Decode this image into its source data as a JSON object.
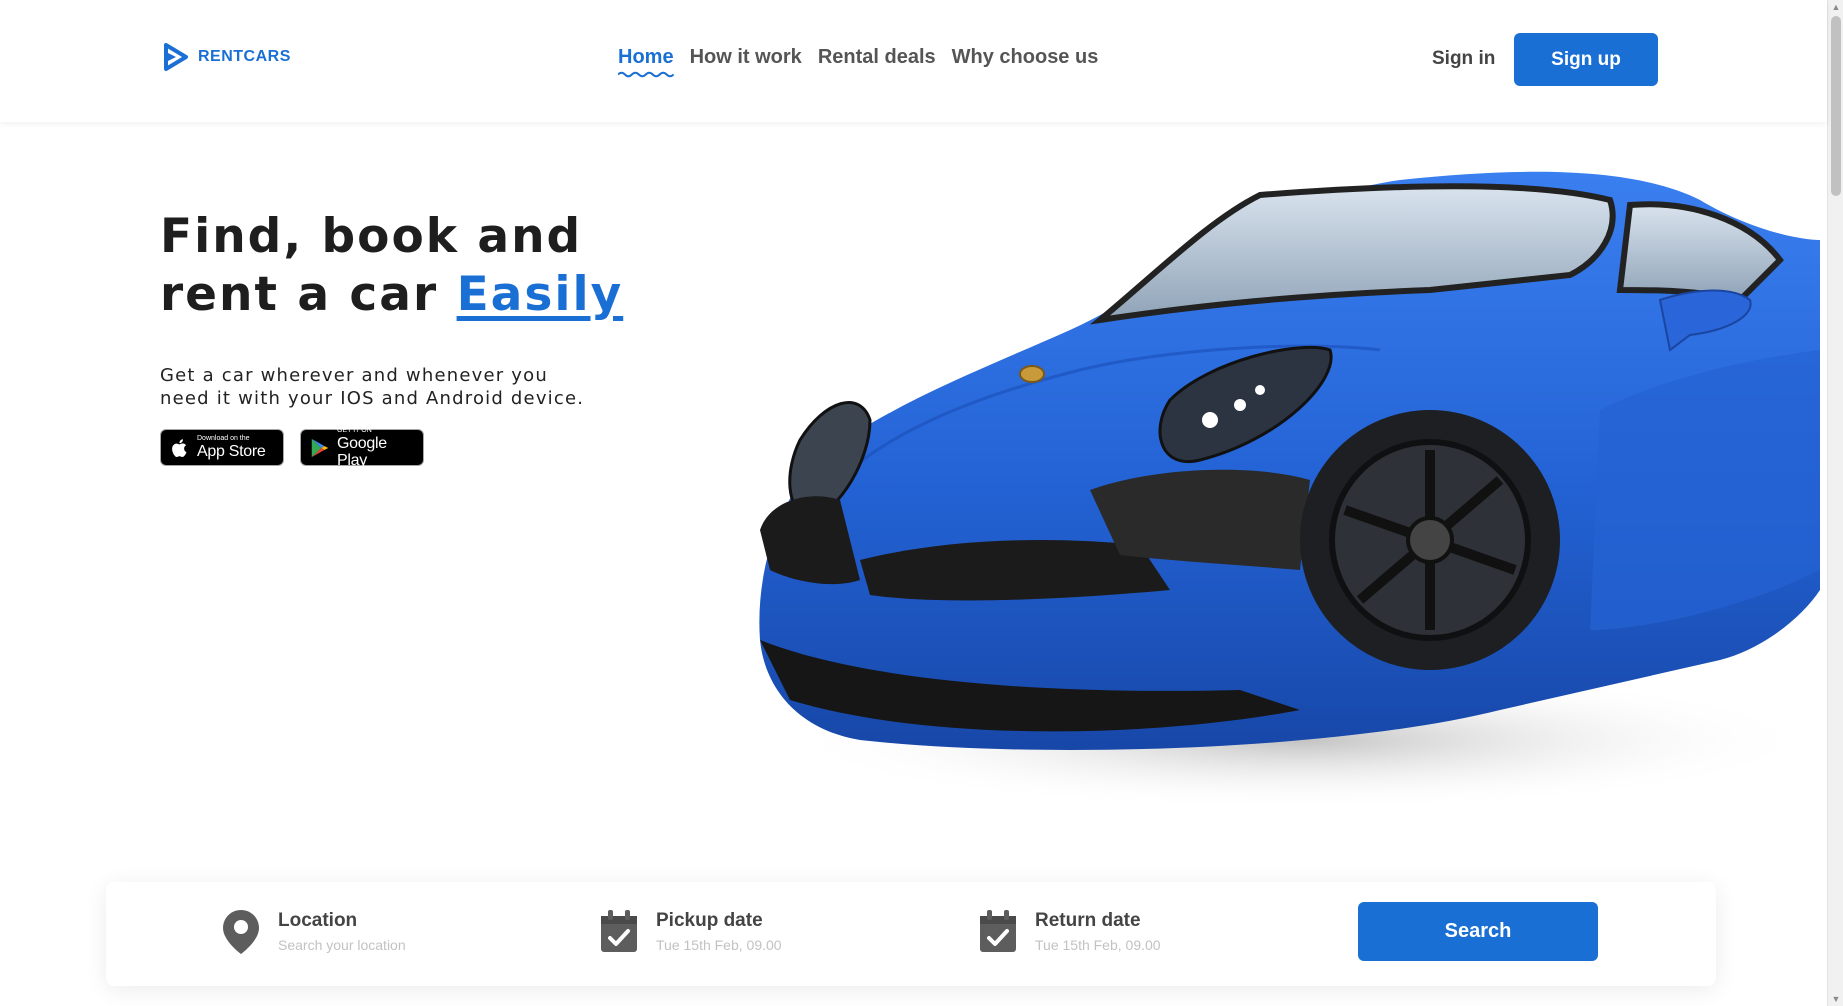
{
  "header": {
    "logo_text": "RENTCARS",
    "nav": [
      {
        "label": "Home",
        "active": true
      },
      {
        "label": "How it work",
        "active": false
      },
      {
        "label": "Rental deals",
        "active": false
      },
      {
        "label": "Why choose us",
        "active": false
      }
    ],
    "sign_in": "Sign in",
    "sign_up": "Sign up"
  },
  "hero": {
    "title_line1": "Find, book and",
    "title_line2_prefix": "rent a car",
    "title_line2_accent": "Easily",
    "subtitle": "Get a car wherever and whenever you need it with your IOS and Android device.",
    "app_store": {
      "small": "Download on the",
      "big": "App Store"
    },
    "google_play": {
      "small": "GET IT ON",
      "big": "Google Play"
    }
  },
  "search": {
    "location": {
      "label": "Location",
      "placeholder": "Search your location",
      "icon": "map-pin-icon"
    },
    "pickup": {
      "label": "Pickup date",
      "value": "Tue 15th Feb, 09.00",
      "icon": "calendar-check-icon"
    },
    "return": {
      "label": "Return date",
      "value": "Tue 15th Feb, 09.00",
      "icon": "calendar-check-icon"
    },
    "button": "Search"
  },
  "colors": {
    "accent": "#1a6fd4",
    "car": "#2667d6"
  }
}
